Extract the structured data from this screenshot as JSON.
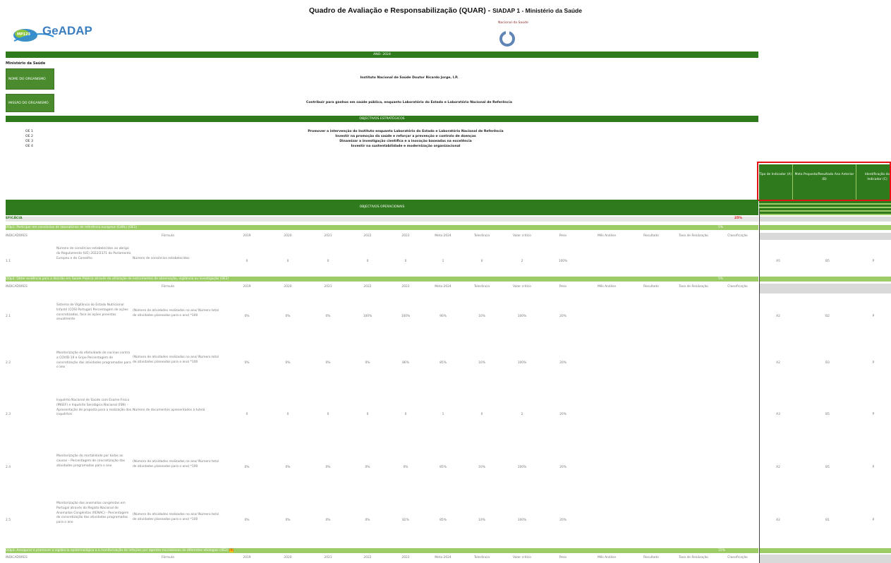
{
  "doc": {
    "title": "Quadro de Avaliação e Responsabilização (QUAR) -",
    "subtitle": "SIADAP 1 - Ministério da Saúde",
    "logo_left_text": "GeADAP",
    "logo_left_small": "MP123",
    "logo_right_text": "Nacional da Saúde",
    "year_bar": "ANO: 2024",
    "ministry": "Ministério da Saúde",
    "org_name_label": "NOME DO ORGANISMO",
    "org_name": "Instituto Nacional de Saúde Doutor Ricardo Jorge, I.P.",
    "mission_label": "MISSÃO DO ORGANISMO",
    "mission": "Contribuir para ganhos em saúde pública, enquanto Laboratório do Estado e Laboratório Nacional de Referência",
    "strategic_bar": "OBJECTIVOS ESTRATÉGICOS",
    "strategic": [
      {
        "code": "OE 1",
        "text": "Promover a intervenção do Instituto enquanto Laboratório do Estado e Laboratório Nacional de Referência"
      },
      {
        "code": "OE 2",
        "text": "Investir na promoção da saúde e reforçar a prevenção e controlo de doenças"
      },
      {
        "code": "OE 3",
        "text": "Dinamizar a investigação científica e a inovação baseadas na excelência"
      },
      {
        "code": "OE 4",
        "text": "Investir na sustentabilidade e modernização organizacional"
      }
    ],
    "right_headers": {
      "a": "Tipo de Indicador (A)",
      "b": "Meta Proposta/Resultado Ano Anterior (B)",
      "c": "Identificação do Indicador (C)"
    },
    "operational_bar": "OBJECTIVOS OPERACIONAIS",
    "eficacia": "EFICÁCIA",
    "eficacia_pct": "25%",
    "columns": [
      "INDICADORES",
      "Fórmula",
      "2019",
      "2020",
      "2021",
      "2022",
      "2023",
      "Meta 2024",
      "Tolerância",
      "Valor crítico",
      "Peso",
      "Mês Análise",
      "Resultado",
      "Taxa de Realização",
      "Classificação"
    ],
    "objectives": [
      {
        "title": "OOp1: Participar em consórcios de laboratórios de referência europeus (EURL) (OE1)",
        "pct": "5%"
      },
      {
        "title": "OOp2: Obter evidência para a decisão em Saúde Pública através da utilização de instrumentos de observação, vigilância ou investigação (OE2)",
        "pct": "5%"
      },
      {
        "title": "OOp3: Assegurar e promover a vigilância epidemiológica e a monitorização de infeções por agentes microbianos de diferentes etiologias (OE2)",
        "pct": "15%",
        "flag": "(R)"
      }
    ],
    "rows": [
      {
        "id": "1.1",
        "name": "Número de consórcios estabelecidos ao abrigo do Regulamento (UE) 2022/2371 do Parlamento Europeu e do Conselho",
        "formula": "Número de consórcios estabelecidos",
        "v2019": "0",
        "v2020": "0",
        "v2021": "0",
        "v2022": "0",
        "v2023": "0",
        "meta": "1",
        "tol": "0",
        "vc": "2",
        "peso": "100%",
        "a": "A5",
        "b": "B5",
        "c": "P"
      },
      {
        "id": "2.1",
        "name": "Sistema de Vigilância do Estado Nutricional Infantil (COSI Portugal) Percentagem de ações concretizadas, face às ações previstas anualmente",
        "formula": "(Número de atividades realizadas no ano/ Número total de atividades planeadas para o ano) *100",
        "v2019": "0%",
        "v2020": "0%",
        "v2021": "0%",
        "v2022": "100%",
        "v2023": "100%",
        "meta": "90%",
        "tol": "10%",
        "vc": "100%",
        "peso": "20%",
        "a": "A2",
        "b": "B2",
        "c": "P"
      },
      {
        "id": "2.2",
        "name": "Monitorização da efetividade de vacinas contra a COVID-19 e Gripe Percentagem de concretização das atividades programadas para o ano",
        "formula": "(Número de atividades realizadas no ano/ Número total de atividades planeadas para o ano) *100",
        "v2019": "0%",
        "v2020": "0%",
        "v2021": "0%",
        "v2022": "0%",
        "v2023": "86%",
        "meta": "85%",
        "tol": "10%",
        "vc": "100%",
        "peso": "20%",
        "a": "A2",
        "b": "B3",
        "c": "P"
      },
      {
        "id": "2.3",
        "name": "Inquérito Nacional de Saúde com Exame Físico (INSEF) e Inquérito Serológico Nacional (ISN) – Apresentação de proposta para a realização dos inquéritos",
        "formula": "Número de documentos apresentados à tutela",
        "v2019": "0",
        "v2020": "0",
        "v2021": "0",
        "v2022": "0",
        "v2023": "0",
        "meta": "1",
        "tol": "0",
        "vc": "2",
        "peso": "20%",
        "a": "A3",
        "b": "B5",
        "c": "P"
      },
      {
        "id": "2.4",
        "name": "Monitorização da mortalidade por todas as causas – Percentagem de concretização das atividades programadas para o ano",
        "formula": "(Número de atividades realizadas no ano/ Número total de atividades planeadas para o ano) *100",
        "v2019": "0%",
        "v2020": "0%",
        "v2021": "0%",
        "v2022": "0%",
        "v2023": "0%",
        "meta": "85%",
        "tol": "10%",
        "vc": "100%",
        "peso": "20%",
        "a": "A2",
        "b": "B5",
        "c": "P"
      },
      {
        "id": "2.5",
        "name": "Monitorização das anomalias congénitas em Portugal através do Registo Nacional de Anomalias Congénitas (RENAC) - Percentagem de concretização das atividades programadas para o ano",
        "formula": "(Número de atividades realizadas no ano/ Número total de atividades planeadas para o ano) *100",
        "v2019": "0%",
        "v2020": "0%",
        "v2021": "0%",
        "v2022": "0%",
        "v2023": "82%",
        "meta": "85%",
        "tol": "10%",
        "vc": "100%",
        "peso": "20%",
        "a": "A2",
        "b": "B1",
        "c": "P"
      }
    ]
  }
}
